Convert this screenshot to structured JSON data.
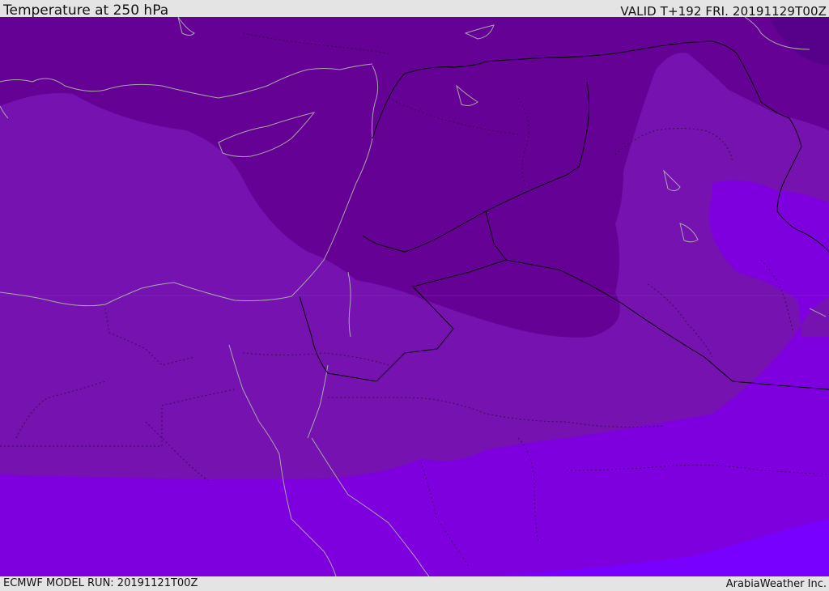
{
  "header": {
    "title": "Temperature at 250 hPa",
    "valid": "VALID T+192 FRI. 20191129T00Z"
  },
  "footer": {
    "model_run": "ECMWF MODEL RUN: 20191121T00Z",
    "brand": "ArabiaWeather Inc."
  },
  "map": {
    "field": "temperature",
    "colors": {
      "darkest": "#55018a",
      "dark": "#650195",
      "mid": "#7512b0",
      "light": "#7e00df",
      "lightest": "#7700ff",
      "coast": "#a8a8a8",
      "border": "#000000"
    }
  }
}
